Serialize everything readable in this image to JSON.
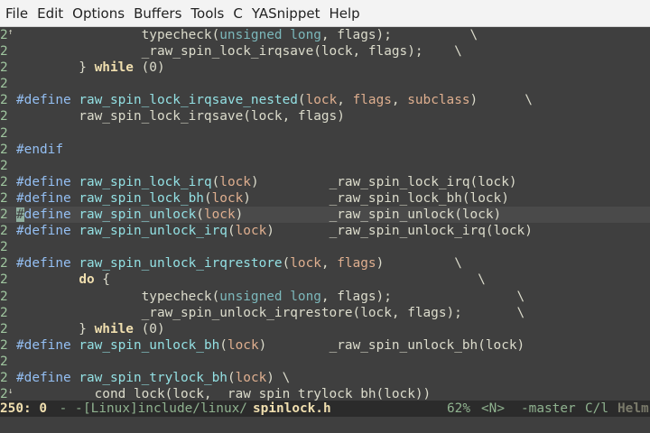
{
  "menu": [
    "File",
    "Edit",
    "Options",
    "Buffers",
    "Tools",
    "C",
    "YASnippet",
    "Help"
  ],
  "editor": {
    "lines": [
      {
        "num": "2",
        "mark": "↑",
        "code": [
          [
            "",
            "                typecheck("
          ],
          [
            "ty",
            "unsigned long"
          ],
          [
            "",
            ", flags);          \\"
          ]
        ]
      },
      {
        "num": "2",
        "code": [
          [
            "",
            "                _raw_spin_lock_irqsave(lock, flags);    \\"
          ]
        ]
      },
      {
        "num": "2",
        "code": [
          [
            "",
            "        } "
          ],
          [
            "kw",
            "while"
          ],
          [
            "",
            " (0)"
          ]
        ]
      },
      {
        "num": "2",
        "code": []
      },
      {
        "num": "2",
        "code": [
          [
            "pp",
            "#define"
          ],
          [
            "",
            " "
          ],
          [
            "fn",
            "raw_spin_lock_irqsave_nested"
          ],
          [
            "",
            "("
          ],
          [
            "var",
            "lock"
          ],
          [
            "",
            ", "
          ],
          [
            "var",
            "flags"
          ],
          [
            "",
            ", "
          ],
          [
            "var",
            "subclass"
          ],
          [
            "",
            ")      \\"
          ]
        ]
      },
      {
        "num": "2",
        "code": [
          [
            "",
            "        raw_spin_lock_irqsave(lock, flags)"
          ]
        ]
      },
      {
        "num": "2",
        "code": []
      },
      {
        "num": "2",
        "code": [
          [
            "pp",
            "#endif"
          ]
        ]
      },
      {
        "num": "2",
        "code": []
      },
      {
        "num": "2",
        "code": [
          [
            "pp",
            "#define"
          ],
          [
            "",
            " "
          ],
          [
            "fn",
            "raw_spin_lock_irq"
          ],
          [
            "",
            "("
          ],
          [
            "var",
            "lock"
          ],
          [
            "",
            ")         _raw_spin_lock_irq(lock)"
          ]
        ]
      },
      {
        "num": "2",
        "code": [
          [
            "pp",
            "#define"
          ],
          [
            "",
            " "
          ],
          [
            "fn",
            "raw_spin_lock_bh"
          ],
          [
            "",
            "("
          ],
          [
            "var",
            "lock"
          ],
          [
            "",
            ")          _raw_spin_lock_bh(lock)"
          ]
        ]
      },
      {
        "num": "2",
        "hl": true,
        "cursor": true,
        "code": [
          [
            "cursor",
            "#"
          ],
          [
            "pp",
            "define"
          ],
          [
            "",
            " "
          ],
          [
            "fn",
            "raw_spin_unlock"
          ],
          [
            "",
            "("
          ],
          [
            "var",
            "lock"
          ],
          [
            "",
            ")           _raw_spin_unlock(lock)"
          ]
        ]
      },
      {
        "num": "2",
        "code": [
          [
            "pp",
            "#define"
          ],
          [
            "",
            " "
          ],
          [
            "fn",
            "raw_spin_unlock_irq"
          ],
          [
            "",
            "("
          ],
          [
            "var",
            "lock"
          ],
          [
            "",
            ")       _raw_spin_unlock_irq(lock)"
          ]
        ]
      },
      {
        "num": "2",
        "code": []
      },
      {
        "num": "2",
        "code": [
          [
            "pp",
            "#define"
          ],
          [
            "",
            " "
          ],
          [
            "fn",
            "raw_spin_unlock_irqrestore"
          ],
          [
            "",
            "("
          ],
          [
            "var",
            "lock"
          ],
          [
            "",
            ", "
          ],
          [
            "var",
            "flags"
          ],
          [
            "",
            ")         \\"
          ]
        ]
      },
      {
        "num": "2",
        "code": [
          [
            "",
            "        "
          ],
          [
            "kw",
            "do"
          ],
          [
            "",
            " {                                               \\"
          ]
        ]
      },
      {
        "num": "2",
        "code": [
          [
            "",
            "                typecheck("
          ],
          [
            "ty",
            "unsigned long"
          ],
          [
            "",
            ", flags);                \\"
          ]
        ]
      },
      {
        "num": "2",
        "code": [
          [
            "",
            "                _raw_spin_unlock_irqrestore(lock, flags);       \\"
          ]
        ]
      },
      {
        "num": "2",
        "code": [
          [
            "",
            "        } "
          ],
          [
            "kw",
            "while"
          ],
          [
            "",
            " (0)"
          ]
        ]
      },
      {
        "num": "2",
        "code": [
          [
            "pp",
            "#define"
          ],
          [
            "",
            " "
          ],
          [
            "fn",
            "raw_spin_unlock_bh"
          ],
          [
            "",
            "("
          ],
          [
            "var",
            "lock"
          ],
          [
            "",
            ")        _raw_spin_unlock_bh(lock)"
          ]
        ]
      },
      {
        "num": "2",
        "code": []
      },
      {
        "num": "2",
        "code": [
          [
            "pp",
            "#define"
          ],
          [
            "",
            " "
          ],
          [
            "fn",
            "raw_spin_trylock_bh"
          ],
          [
            "",
            "("
          ],
          [
            "var",
            "lock"
          ],
          [
            "",
            ") \\"
          ]
        ]
      },
      {
        "num": "2",
        "mark": "↓",
        "code": [
          [
            "",
            "          cond_lock(lock, _raw_spin_trylock_bh(lock))"
          ]
        ]
      }
    ]
  },
  "modeline": {
    "position": "250: 0",
    "dashes": " - -",
    "path": "[Linux]include/linux/",
    "filename": "spinlock.h",
    "percent": "62%",
    "state": "<N>",
    "branch": "-master",
    "mode": "C/l",
    "helm": "Helm"
  },
  "colors": {
    "background": "#3f3f3f",
    "foreground": "#dcdccc",
    "keyword": "#f0dfaf",
    "preprocessor": "#94bff3",
    "function": "#93e0e3",
    "type": "#7cb8bb",
    "variable": "#dfaf8f",
    "line_number": "#9fc59f",
    "modeline_bg": "#2b2b2b",
    "menubar_bg": "#f3f3f3"
  }
}
